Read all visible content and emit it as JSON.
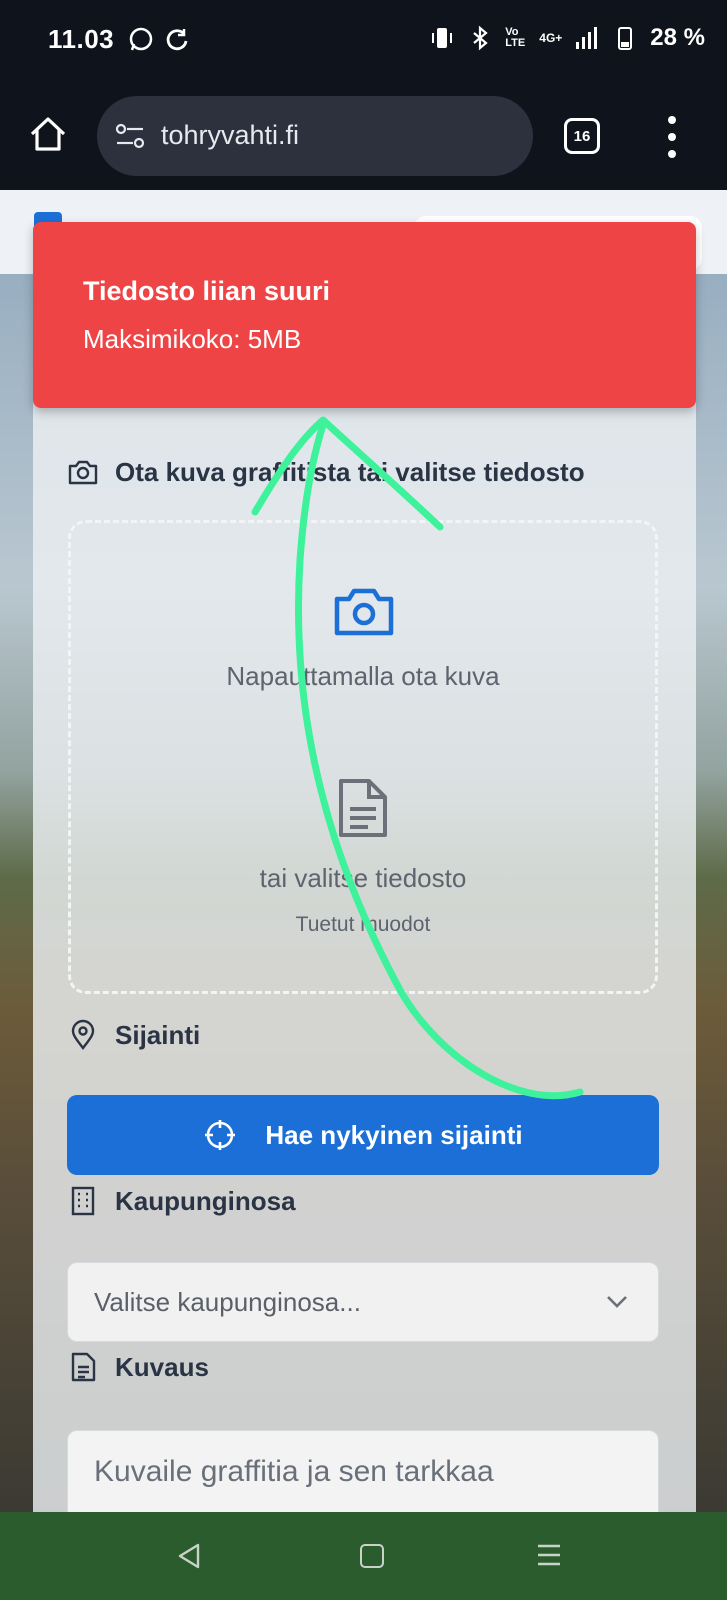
{
  "status_bar": {
    "time": "11.03",
    "battery": "28 %",
    "network": "4G+",
    "volte": "Vo LTE"
  },
  "browser": {
    "url": "tohryvahti.fi",
    "tab_count": "16"
  },
  "toast": {
    "title": "Tiedosto liian suuri",
    "message": "Maksimikoko: 5MB",
    "color": "#ef4445"
  },
  "form": {
    "photo_label": "Ota kuva graffitista tai valitse tiedosto",
    "upload_tap": "Napauttamalla ota kuva",
    "upload_or": "tai valitse tiedosto",
    "upload_formats": "Tuetut muodot",
    "location_label": "Sijainti",
    "location_button": "Hae nykyinen sijainti",
    "district_label": "Kaupunginosa",
    "district_placeholder": "Valitse kaupunginosa...",
    "description_label": "Kuvaus",
    "description_placeholder": "Kuvaile graffitia ja sen tarkkaa"
  },
  "colors": {
    "primary": "#1c6fd6",
    "annotation": "#3df29a",
    "nav_bar": "#2b5c2e"
  }
}
